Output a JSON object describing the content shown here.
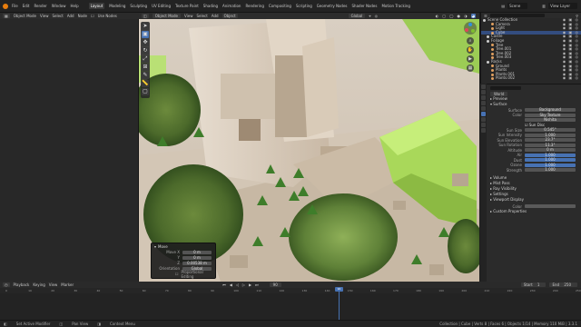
{
  "topbar": {
    "menus": [
      "File",
      "Edit",
      "Render",
      "Window",
      "Help"
    ],
    "tabs": [
      "Layout",
      "Modeling",
      "Sculpting",
      "UV Editing",
      "Texture Paint",
      "Shading",
      "Animation",
      "Rendering",
      "Compositing",
      "Scripting",
      "Geometry Nodes",
      "Shader Nodes",
      "Motion Tracking"
    ],
    "active_tab": "Layout",
    "scene": "Scene",
    "view_layer": "View Layer"
  },
  "left_header": [
    "Object Mode",
    "View",
    "Select",
    "Add",
    "Node",
    "Use Nodes"
  ],
  "viewport_header": {
    "mode": "Object Mode",
    "menus": [
      "View",
      "Select",
      "Add",
      "Object"
    ],
    "orientation": "Global"
  },
  "toolbar_icons": [
    "cursor-icon",
    "select-box-icon",
    "move-icon",
    "rotate-icon",
    "scale-icon",
    "transform-icon",
    "annotate-icon",
    "measure-icon",
    "add-cube-icon"
  ],
  "operator_panel": {
    "title": "Move",
    "rows": [
      {
        "label": "Move X",
        "value": "0 m"
      },
      {
        "label": "Y",
        "value": "0 m"
      },
      {
        "label": "Z",
        "value": "0.00538 m"
      },
      {
        "label": "Orientation",
        "value": "Global"
      },
      {
        "label": "Proportional Editing",
        "value": ""
      }
    ]
  },
  "outliner": {
    "items": [
      {
        "name": "Scene Collection",
        "color": "#cfcfcf",
        "selected": false
      },
      {
        "name": "Camera",
        "color": "#e0a060",
        "selected": false
      },
      {
        "name": "Light",
        "color": "#e0a060",
        "selected": false
      },
      {
        "name": "Cube",
        "color": "#e0a060",
        "selected": true
      },
      {
        "name": "Castle",
        "color": "#cfcfcf",
        "selected": false
      },
      {
        "name": "Foliage",
        "color": "#cfcfcf",
        "selected": false
      },
      {
        "name": "Tree",
        "color": "#e0a060",
        "selected": false
      },
      {
        "name": "Tree.001",
        "color": "#e0a060",
        "selected": false
      },
      {
        "name": "Tree.002",
        "color": "#e0a060",
        "selected": false
      },
      {
        "name": "Tree.003",
        "color": "#e0a060",
        "selected": false
      },
      {
        "name": "Rocks",
        "color": "#cfcfcf",
        "selected": false
      },
      {
        "name": "Ground",
        "color": "#e0a060",
        "selected": false
      },
      {
        "name": "Plants",
        "color": "#e0a060",
        "selected": false
      },
      {
        "name": "Plants.001",
        "color": "#e0a060",
        "selected": false
      },
      {
        "name": "Plants.002",
        "color": "#e0a060",
        "selected": false
      }
    ],
    "visibility_glyphs": "◉ ▣ ◎"
  },
  "properties": {
    "object_name": "World",
    "sections": [
      "Preview",
      "Surface"
    ],
    "surface_label": "Surface",
    "surface_value": "Background",
    "color_label": "Color",
    "color_value": "Sky Texture",
    "sky_type": "Nishita",
    "sun_disc": "Sun Disc",
    "rows": [
      {
        "label": "Sun Size",
        "value": "0.545°"
      },
      {
        "label": "Sun Intensity",
        "value": "1.000"
      },
      {
        "label": "Sun Elevation",
        "value": "23.7°"
      },
      {
        "label": "Sun Rotation",
        "value": "11.3°"
      },
      {
        "label": "Altitude",
        "value": "0 m"
      },
      {
        "label": "Air",
        "value": "1.000"
      },
      {
        "label": "Dust",
        "value": "1.000"
      },
      {
        "label": "Ozone",
        "value": "1.000"
      },
      {
        "label": "Strength",
        "value": "1.000"
      }
    ],
    "footer_sections": [
      "Volume",
      "Mist Pass",
      "Ray Visibility",
      "Settings",
      "Viewport Display"
    ],
    "color_row": "Color",
    "custom_properties": "Custom Properties"
  },
  "timeline": {
    "menus": [
      "Playback",
      "Keying",
      "View",
      "Marker"
    ],
    "current_frame": "90",
    "start_label": "Start",
    "start": "1",
    "end_label": "End",
    "end": "250",
    "ticks": [
      "0",
      "10",
      "20",
      "30",
      "40",
      "50",
      "60",
      "70",
      "80",
      "90",
      "100",
      "110",
      "120",
      "130",
      "140",
      "150",
      "160",
      "170",
      "180",
      "190",
      "200",
      "210",
      "220",
      "230",
      "240",
      "250"
    ]
  },
  "statusbar": {
    "left": "Set Active Modifier",
    "middle": "Pan View",
    "right_a": "Context Menu",
    "stats": "Collection | Cube | Verts 8 | Faces 6 | Objects 1/14 | Memory 110 MiB | 3.3.1"
  },
  "colors": {
    "accent": "#4772b3",
    "logo": "#e87d0d",
    "panel": "#282828"
  }
}
